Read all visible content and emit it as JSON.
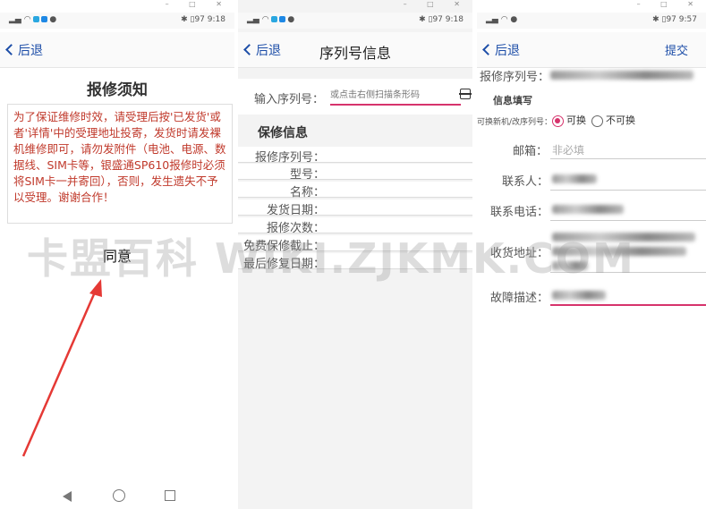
{
  "panel1": {
    "status_time": "9:18",
    "status_battery": "97",
    "back_label": "后退",
    "heading": "报修须知",
    "notice": "为了保证维修时效，请受理后按'已发货'或者'详情'中的受理地址投寄，发货时请发裸机维修即可，请勿发附件（电池、电源、数据线、SIM卡等，银盛通SP610报修时必须将SIM卡一并寄回），否则，发生遗失不予以受理。谢谢合作！",
    "agree_label": "同意"
  },
  "panel2": {
    "status_time": "9:18",
    "status_battery": "97",
    "back_label": "后退",
    "title": "序列号信息",
    "serial_label": "输入序列号：",
    "serial_placeholder": "或点击右侧扫描条形码",
    "section_title": "保修信息",
    "info_labels": [
      "报修序列号：",
      "型号：",
      "名称：",
      "发货日期：",
      "报修次数：",
      "免费保修截止：",
      "最后修复日期："
    ]
  },
  "panel3": {
    "status_time": "9:57",
    "status_battery": "97",
    "back_label": "后退",
    "submit_label": "提交",
    "serial_label": "报修序列号：",
    "section_title": "信息填写",
    "replace_label": "可换新机/改序列号：",
    "radio_yes": "可换",
    "radio_no": "不可换",
    "email_label": "邮箱：",
    "email_placeholder": "非必填",
    "contact_label": "联系人：",
    "phone_label": "联系电话：",
    "address_label": "收货地址：",
    "fault_label": "故障描述："
  },
  "watermark": "卡盟百科 WIKI.ZJKMK.COM",
  "colors": {
    "accent_blue": "#1d4ea8",
    "accent_pink": "#d6336c",
    "notice_red": "#c0392b",
    "arrow_red": "#e53935"
  }
}
